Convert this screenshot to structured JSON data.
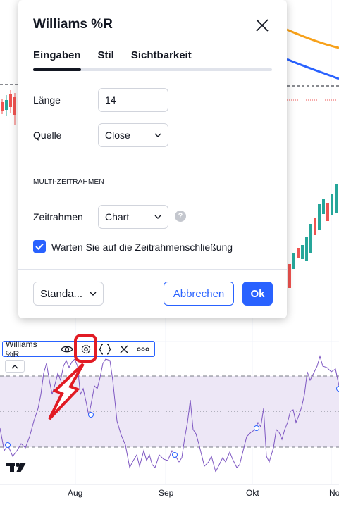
{
  "dialog": {
    "title": "Williams %R",
    "tabs": [
      {
        "label": "Eingaben",
        "active": true
      },
      {
        "label": "Stil",
        "active": false
      },
      {
        "label": "Sichtbarkeit",
        "active": false
      }
    ],
    "length": {
      "label": "Länge",
      "value": "14"
    },
    "source": {
      "label": "Quelle",
      "value": "Close"
    },
    "section_header": "MULTI-ZEITRAHMEN",
    "timeframe": {
      "label": "Zeitrahmen",
      "value": "Chart"
    },
    "wait_checkbox": {
      "label": "Warten Sie auf die Zeitrahmenschließung",
      "checked": true
    },
    "defaults": {
      "value": "Standa..."
    },
    "cancel_label": "Abbrechen",
    "ok_label": "Ok"
  },
  "legend": {
    "name": "Williams %R",
    "icons": [
      "eye-icon",
      "gear-icon",
      "code-braces-icon",
      "close-icon",
      "more-icon"
    ]
  },
  "x_axis": {
    "labels": [
      "Aug",
      "Sep",
      "Okt",
      "No"
    ]
  },
  "colors": {
    "accent": "#2962ff",
    "indicator_line": "#7e57c2",
    "band_fill": "#ede7f6",
    "up_candle": "#26a69a",
    "down_candle": "#ef5350",
    "ma_orange": "#f7a11a",
    "ma_blue": "#2962ff",
    "annotation_red": "#e11b24"
  }
}
